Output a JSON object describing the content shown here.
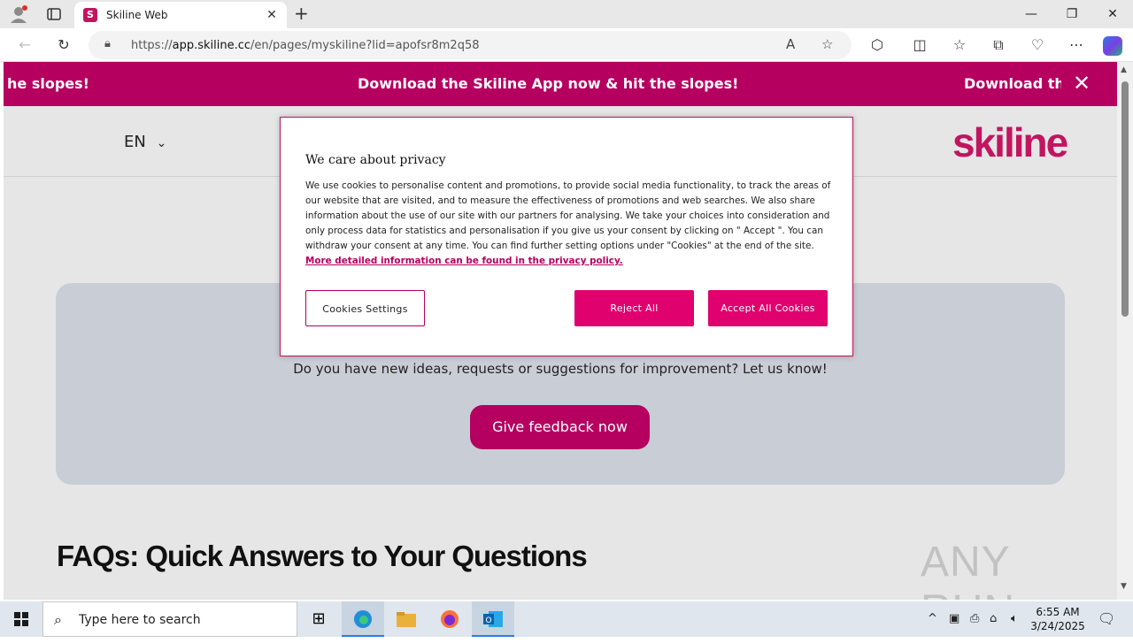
{
  "browser": {
    "tab_title": "Skiline Web",
    "tab_favicon_letter": "S",
    "url_prefix": "https://",
    "url_domain": "app.skiline.cc",
    "url_path": "/en/pages/myskiline?lid=apofsr8m2q58"
  },
  "banner": {
    "left_fragment": "he slopes!",
    "center_text": "Download the Skiline App now & hit the slopes!",
    "right_fragment": "Download the"
  },
  "header": {
    "language": "EN",
    "logo_text": "skiline"
  },
  "cookie": {
    "heading": "We care about privacy",
    "body": "We use cookies to personalise content and promotions, to provide social media functionality, to track the areas of our website that are visited, and to measure the effectiveness of promotions and web searches. We also share information about the use of our site with our partners for analysing. We take your choices into consideration and only process data for statistics and personalisation if you give us your consent by clicking on \" Accept \". You can withdraw your consent at any time. You can find further setting options under \"Cookies\" at the end of the site.",
    "link_text": "More detailed information can be found in the privacy policy.",
    "settings_label": "Cookies Settings",
    "reject_label": "Reject All",
    "accept_label": "Accept All Cookies"
  },
  "feedback": {
    "question": "Do you have new ideas, requests or suggestions for improvement? Let us know!",
    "button_label": "Give feedback now"
  },
  "faq": {
    "title": "FAQs: Quick Answers to Your Questions"
  },
  "watermark": "ANY RUN",
  "taskbar": {
    "search_placeholder": "Type here to search",
    "time": "6:55 AM",
    "date": "3/24/2025"
  },
  "colors": {
    "brand": "#b5005f",
    "accent_button": "#e0006e"
  }
}
